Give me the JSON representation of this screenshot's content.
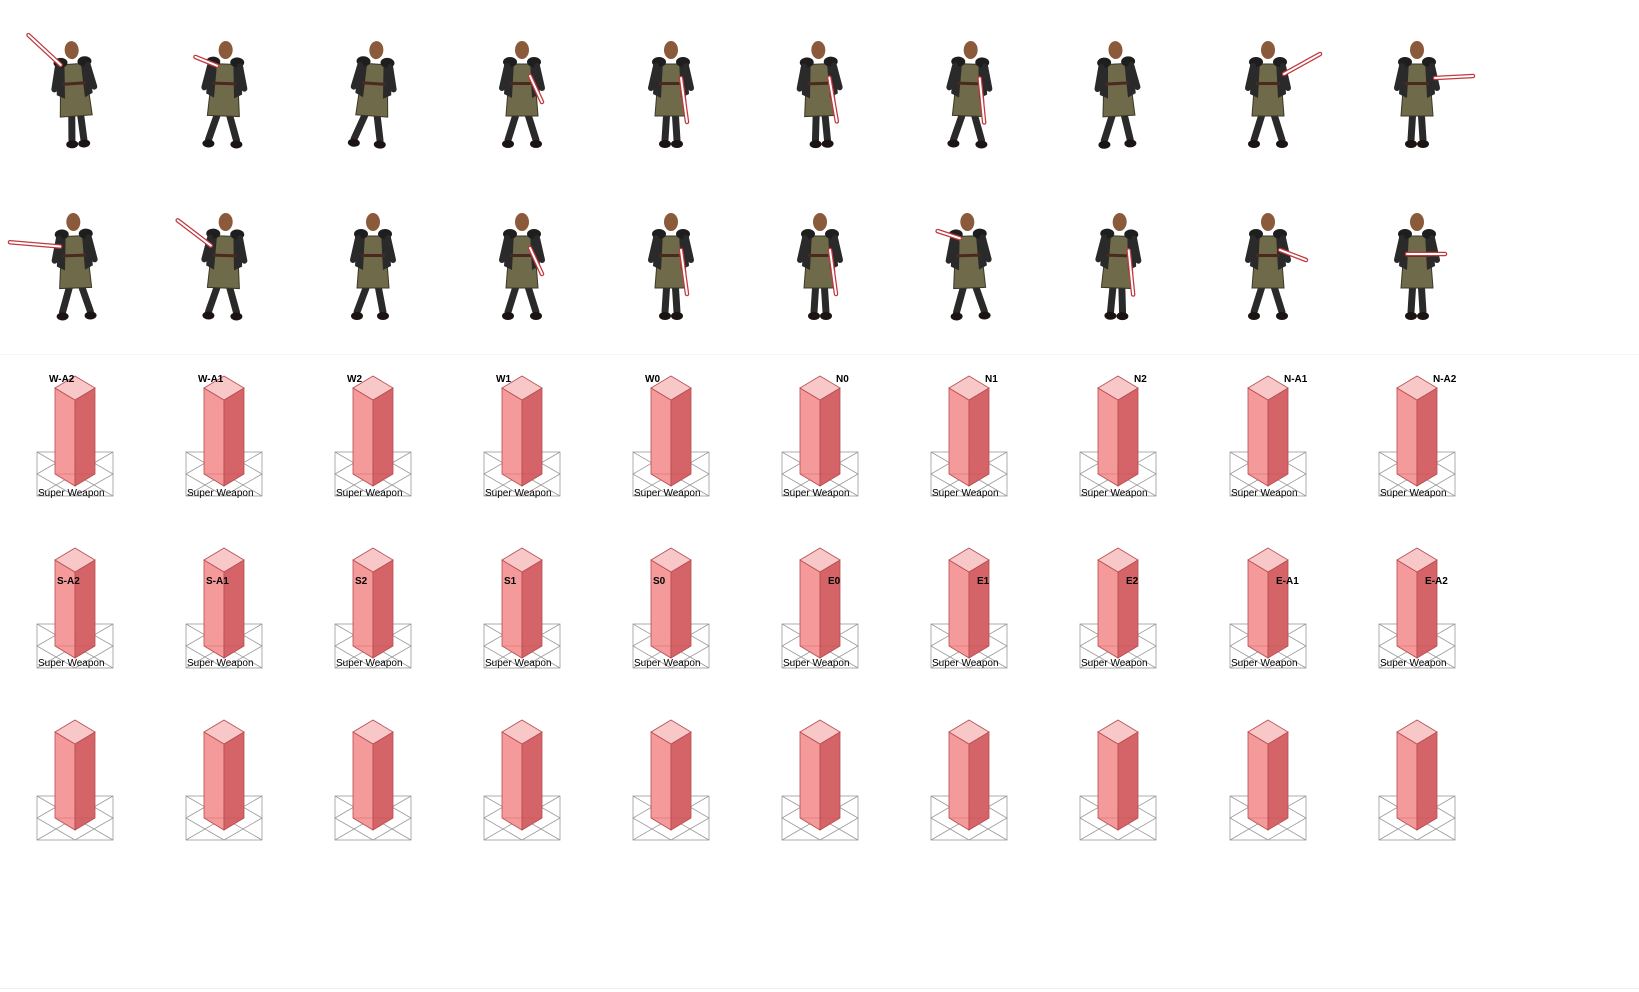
{
  "sheet": {
    "sprite_rows": 2,
    "frames_per_row": 10,
    "character_icon": "knight-with-sword-sprite",
    "colors": {
      "box_front": "#f59a9a",
      "box_side": "#d46468",
      "box_top": "#f8c8c8",
      "box_stroke": "#b84b4e",
      "footprint": "#9a9a9a",
      "tunic": "#6f6a4a",
      "armor": "#2a2a2a",
      "skin": "#8a5a3a",
      "sword": "#ffffff",
      "sword_outline": "#c0393f"
    }
  },
  "labels_row1": [
    {
      "dir": "W-A2",
      "sub": "Super Weapon"
    },
    {
      "dir": "W-A1",
      "sub": "Super Weapon"
    },
    {
      "dir": "W2",
      "sub": "Super Weapon"
    },
    {
      "dir": "W1",
      "sub": "Super Weapon"
    },
    {
      "dir": "W0",
      "sub": "Super Weapon"
    },
    {
      "dir": "N0",
      "sub": "Super Weapon"
    },
    {
      "dir": "N1",
      "sub": "Super Weapon"
    },
    {
      "dir": "N2",
      "sub": "Super Weapon"
    },
    {
      "dir": "N-A1",
      "sub": "Super Weapon"
    },
    {
      "dir": "N-A2",
      "sub": "Super Weapon"
    }
  ],
  "labels_row2": [
    {
      "dir": "S-A2",
      "sub": "Super Weapon"
    },
    {
      "dir": "S-A1",
      "sub": "Super Weapon"
    },
    {
      "dir": "S2",
      "sub": "Super Weapon"
    },
    {
      "dir": "S1",
      "sub": "Super Weapon"
    },
    {
      "dir": "S0",
      "sub": "Super Weapon"
    },
    {
      "dir": "E0",
      "sub": "Super Weapon"
    },
    {
      "dir": "E1",
      "sub": "Super Weapon"
    },
    {
      "dir": "E2",
      "sub": "Super Weapon"
    },
    {
      "dir": "E-A1",
      "sub": "Super Weapon"
    },
    {
      "dir": "E-A2",
      "sub": "Super Weapon"
    }
  ],
  "labels_row3": [
    {
      "dir": "",
      "sub": ""
    },
    {
      "dir": "",
      "sub": ""
    },
    {
      "dir": "",
      "sub": ""
    },
    {
      "dir": "",
      "sub": ""
    },
    {
      "dir": "",
      "sub": ""
    },
    {
      "dir": "",
      "sub": ""
    },
    {
      "dir": "",
      "sub": ""
    },
    {
      "dir": "",
      "sub": ""
    },
    {
      "dir": "",
      "sub": ""
    },
    {
      "dir": "",
      "sub": ""
    }
  ]
}
